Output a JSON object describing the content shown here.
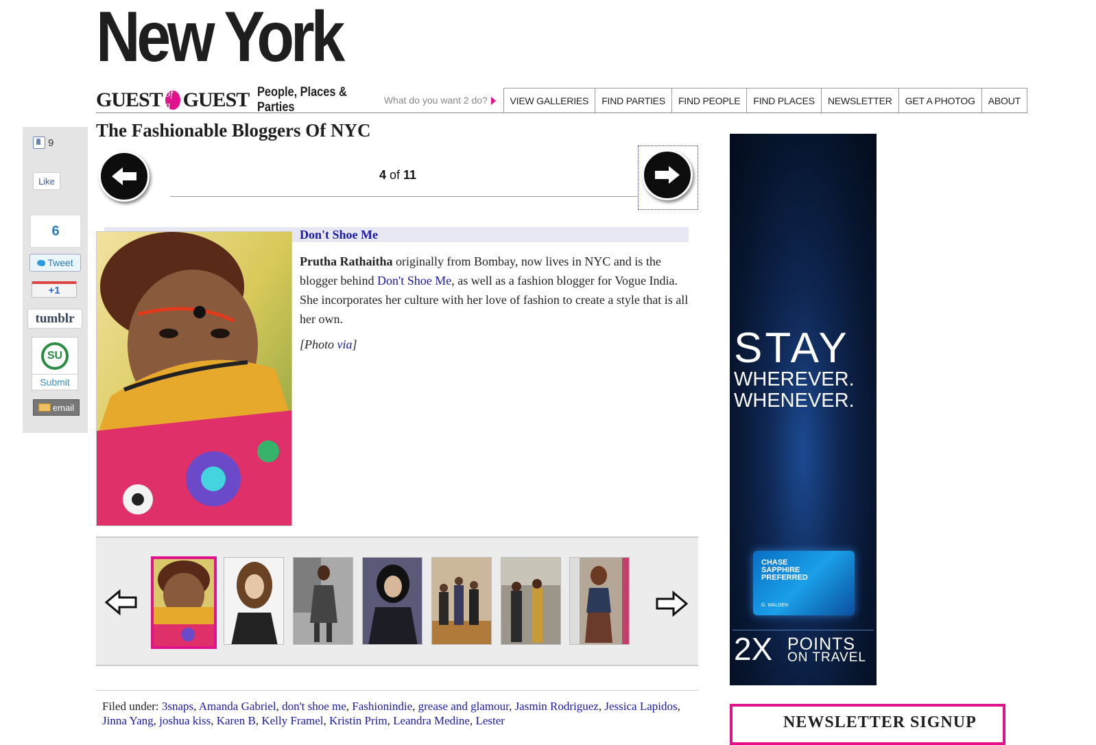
{
  "masthead": {
    "city": "New York"
  },
  "brand": {
    "word1": "GUEST",
    "of": "of a",
    "word2": "GUEST",
    "tagline": "People, Places & Parties"
  },
  "nav": {
    "search_prompt": "What do you want 2 do?",
    "items": [
      "VIEW GALLERIES",
      "FIND PARTIES",
      "FIND PEOPLE",
      "FIND PLACES",
      "NEWSLETTER",
      "GET A PHOTOG",
      "ABOUT"
    ]
  },
  "social": {
    "fb_count": "9",
    "fb_like": "Like",
    "tweet_count": "6",
    "tweet": "Tweet",
    "gplus": "+1",
    "tumblr": "tumblr",
    "stumble_icon": "SU",
    "submit": "Submit",
    "email": "email"
  },
  "article": {
    "title": "The Fashionable Bloggers Of NYC",
    "counter_current": "4",
    "counter_of": "of",
    "counter_total": "11",
    "subtitle": "Don't Shoe Me",
    "body_name": "Prutha Rathaitha",
    "body_part1": " originally from Bombay, now lives in NYC and is the blogger behind ",
    "body_link": "Don't Shoe Me",
    "body_part2": ", as well as a fashion blogger for Vogue India. She incorporates her culture with her love of fashion to create a style that is all her own.",
    "credit_prefix": "[Photo ",
    "credit_link": "via",
    "credit_suffix": "]"
  },
  "thumbnails": {
    "count_visible": 7,
    "active_index": 0
  },
  "filed_under": {
    "label": "Filed under:",
    "tags": [
      "3snaps",
      "Amanda Gabriel",
      "don't shoe me",
      "Fashionindie",
      "grease and glamour",
      "Jasmin Rodriguez",
      "Jessica Lapidos",
      "Jinna Yang",
      "joshua kiss",
      "Karen B",
      "Kelly Framel",
      "Kristin Prim",
      "Leandra Medine",
      "Lester"
    ]
  },
  "ad": {
    "headline": "STAY",
    "line2": "WHEREVER.",
    "line3": "WHENEVER.",
    "card_brand": "CHASE",
    "card_line1": "SAPPHIRE",
    "card_line2": "PREFERRED",
    "card_name": "G. WALDEN",
    "big": "2X",
    "points": "POINTS",
    "travel": "ON TRAVEL"
  },
  "newsletter": {
    "title": "NEWSLETTER SIGNUP"
  },
  "colors": {
    "accent": "#e0138c",
    "link": "#1a1aa6",
    "ad_bg": "#07152e"
  }
}
